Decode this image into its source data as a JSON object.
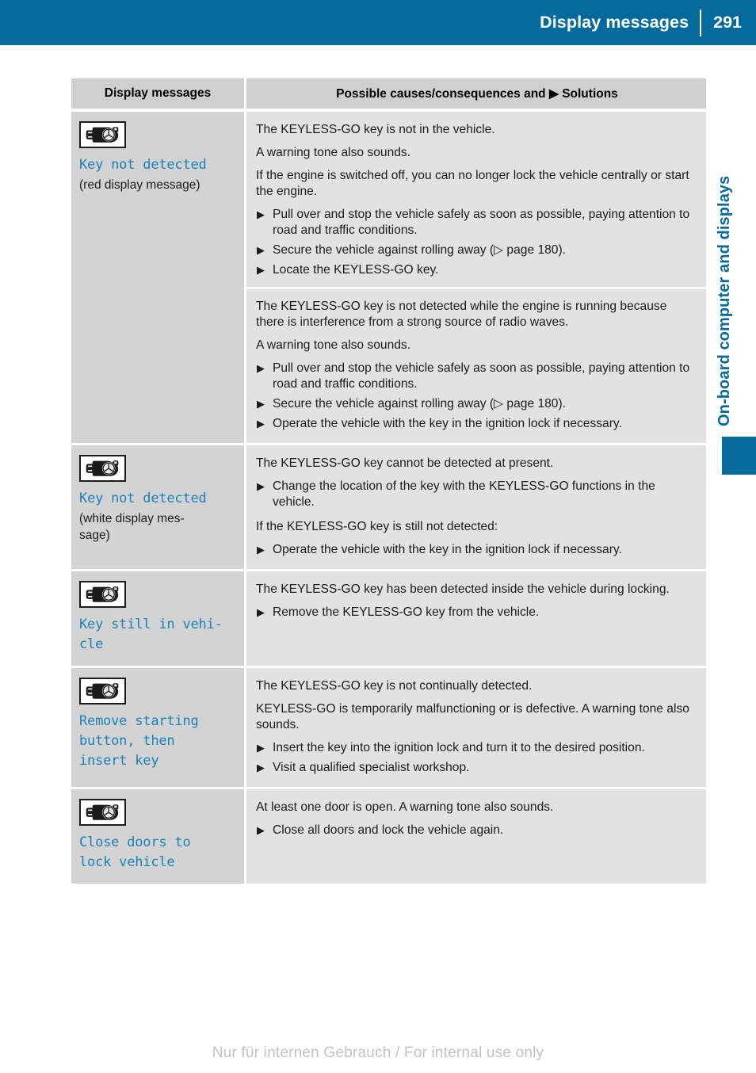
{
  "header": {
    "title": "Display messages",
    "page_number": "291",
    "bar_color": "#056b9c"
  },
  "side_tab": {
    "label": "On-board computer and displays",
    "color": "#056b9c"
  },
  "table": {
    "columns": {
      "left_header": "Display messages",
      "right_header_pre": "Possible causes/consequences and ",
      "right_header_bullet": "▶",
      "right_header_post": " Solutions"
    },
    "rows": [
      {
        "icon": "keyless-go-key-icon",
        "message": "Key not detected",
        "note": "(red display message)",
        "blocks": [
          {
            "paragraphs": [
              "The KEYLESS-GO key is not in the vehicle.",
              "A warning tone also sounds.",
              "If the engine is switched off, you can no longer lock the vehicle centrally or start the engine."
            ],
            "steps": [
              "Pull over and stop the vehicle safely as soon as possible, paying attention to road and traffic conditions.",
              "Secure the vehicle against rolling away (▷ page 180).",
              "Locate the KEYLESS-GO key."
            ]
          },
          {
            "separator_before": true,
            "paragraphs": [
              "The KEYLESS-GO key is not detected while the engine is running because there is interference from a strong source of radio waves.",
              "A warning tone also sounds."
            ],
            "steps": [
              "Pull over and stop the vehicle safely as soon as possible, paying attention to road and traffic conditions.",
              "Secure the vehicle against rolling away (▷ page 180).",
              "Operate the vehicle with the key in the ignition lock if necessary."
            ]
          }
        ]
      },
      {
        "icon": "keyless-go-key-icon",
        "message": "Key not detected",
        "note": "(white display mes-\nsage)",
        "blocks": [
          {
            "paragraphs": [
              "The KEYLESS-GO key cannot be detected at present."
            ],
            "steps": [
              "Change the location of the key with the KEYLESS-GO functions in the vehicle."
            ]
          },
          {
            "paragraphs": [
              "If the KEYLESS-GO key is still not detected:"
            ],
            "steps": [
              "Operate the vehicle with the key in the ignition lock if necessary."
            ]
          }
        ]
      },
      {
        "icon": "keyless-go-key-icon",
        "message": "Key still in vehi-\ncle",
        "note": "",
        "blocks": [
          {
            "paragraphs": [
              "The KEYLESS-GO key has been detected inside the vehicle during locking."
            ],
            "steps": [
              "Remove the KEYLESS-GO key from the vehicle."
            ]
          }
        ]
      },
      {
        "icon": "keyless-go-key-icon",
        "message": "Remove starting\nbutton, then\ninsert key",
        "note": "",
        "blocks": [
          {
            "paragraphs": [
              "The KEYLESS-GO key is not continually detected.",
              "KEYLESS-GO is temporarily malfunctioning or is defective. A warning tone also sounds."
            ],
            "steps": [
              "Insert the key into the ignition lock and turn it to the desired position.",
              "Visit a qualified specialist workshop."
            ]
          }
        ]
      },
      {
        "icon": "keyless-go-key-icon",
        "message": "Close doors to\nlock vehicle",
        "note": "",
        "blocks": [
          {
            "paragraphs": [
              "At least one door is open. A warning tone also sounds."
            ],
            "steps": [
              "Close all doors and lock the vehicle again."
            ]
          }
        ]
      }
    ]
  },
  "footer": {
    "watermark": "Nur für internen Gebrauch / For internal use only"
  }
}
